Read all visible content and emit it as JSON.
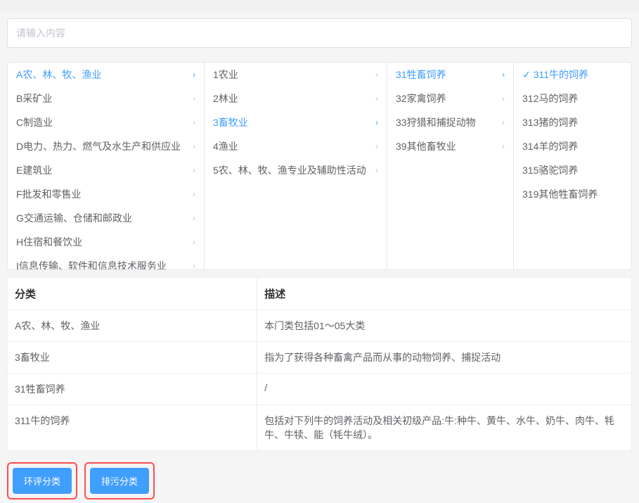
{
  "search": {
    "placeholder": "请输入内容"
  },
  "cascader": {
    "columns": [
      {
        "id": "col1",
        "items": [
          {
            "label": "A农、林、牧、渔业",
            "hasChildren": true,
            "active": true
          },
          {
            "label": "B采矿业",
            "hasChildren": true
          },
          {
            "label": "C制造业",
            "hasChildren": true
          },
          {
            "label": "D电力、热力、燃气及水生产和供应业",
            "hasChildren": true
          },
          {
            "label": "E建筑业",
            "hasChildren": true
          },
          {
            "label": "F批发和零售业",
            "hasChildren": true
          },
          {
            "label": "G交通运输、仓储和邮政业",
            "hasChildren": true
          },
          {
            "label": "H住宿和餐饮业",
            "hasChildren": true
          },
          {
            "label": "I信息传输、软件和信息技术服务业",
            "hasChildren": true
          }
        ]
      },
      {
        "id": "col2",
        "items": [
          {
            "label": "1农业",
            "hasChildren": true
          },
          {
            "label": "2林业",
            "hasChildren": true
          },
          {
            "label": "3畜牧业",
            "hasChildren": true,
            "active": true
          },
          {
            "label": "4渔业",
            "hasChildren": true
          },
          {
            "label": "5农、林、牧、渔专业及辅助性活动",
            "hasChildren": true
          }
        ]
      },
      {
        "id": "col3",
        "items": [
          {
            "label": "31牲畜饲养",
            "hasChildren": true,
            "active": true
          },
          {
            "label": "32家禽饲养",
            "hasChildren": true
          },
          {
            "label": "33狩猎和捕捉动物",
            "hasChildren": true
          },
          {
            "label": "39其他畜牧业",
            "hasChildren": true
          }
        ]
      },
      {
        "id": "col4",
        "items": [
          {
            "label": "311牛的饲养",
            "selected": true
          },
          {
            "label": "312马的饲养"
          },
          {
            "label": "313猪的饲养"
          },
          {
            "label": "314羊的饲养"
          },
          {
            "label": "315骆驼饲养"
          },
          {
            "label": "319其他牲畜饲养"
          }
        ]
      }
    ]
  },
  "table": {
    "headers": {
      "category": "分类",
      "description": "描述"
    },
    "rows": [
      {
        "category": "A农、林、牧、渔业",
        "description": "本门类包括01〜05大类"
      },
      {
        "category": "3畜牧业",
        "description": "指为了获得各种畜禽产品而从事的动物饲养、捕捉活动"
      },
      {
        "category": "31牲畜饲养",
        "description": "/"
      },
      {
        "category": "311牛的饲养",
        "description": "包括对下列牛的饲养活动及相关初级产品:牛:种牛、黄牛、水牛、奶牛、肉牛、牦牛、牛犊、能（牦牛绒）。"
      }
    ]
  },
  "buttons": {
    "huanping": "环评分类",
    "paiwu": "排污分类"
  }
}
